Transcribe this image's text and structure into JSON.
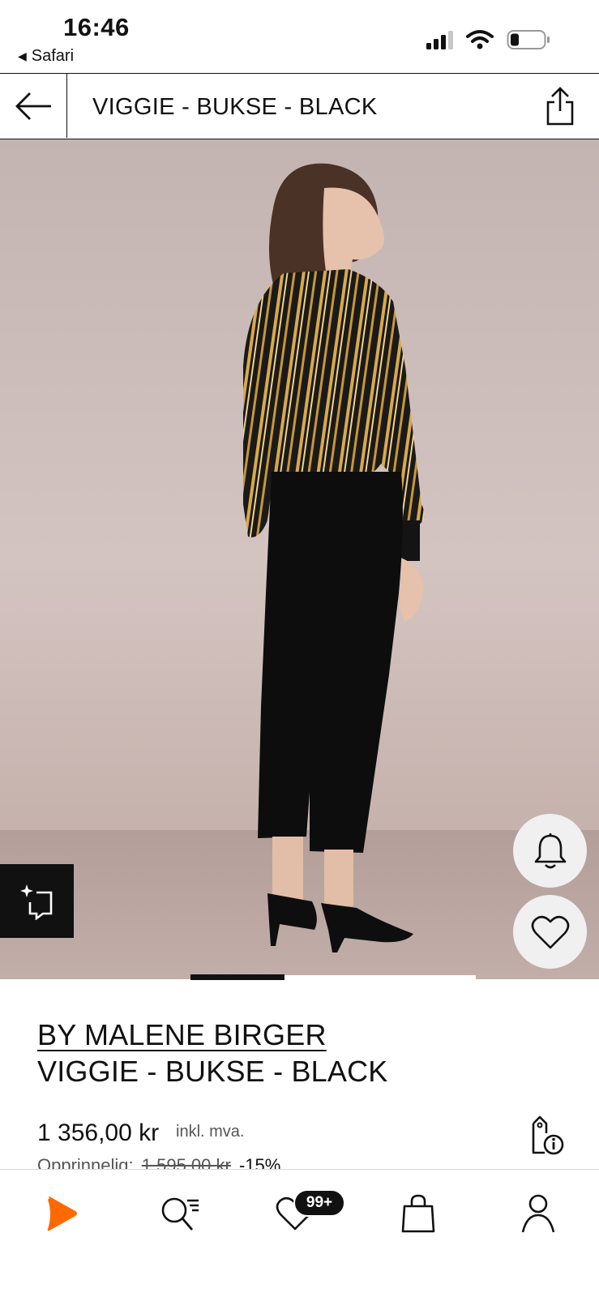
{
  "status_bar": {
    "time": "16:46",
    "back_app": "Safari",
    "back_glyph": "◀"
  },
  "header": {
    "title": "VIGGIE - BUKSE - BLACK",
    "back_icon": "arrow-left-icon",
    "share_icon": "share-icon"
  },
  "gallery": {
    "current_index": 1,
    "progress_fraction": 0.33
  },
  "product": {
    "brand": "BY MALENE BIRGER",
    "name": "VIGGIE - BUKSE - BLACK",
    "price": "1 356,00 kr",
    "tax_note": "inkl. mva.",
    "original_label": "Opprinnelig:",
    "original_price": "1 595,00 kr",
    "discount": "-15%"
  },
  "bottom_nav": {
    "cart_badge": "99+",
    "items": [
      "home-icon",
      "search-icon",
      "wishlist-icon",
      "bag-icon",
      "profile-icon"
    ]
  },
  "colors": {
    "accent": "#ff6900",
    "text": "#111111",
    "backdrop": "#cdbcb9"
  }
}
